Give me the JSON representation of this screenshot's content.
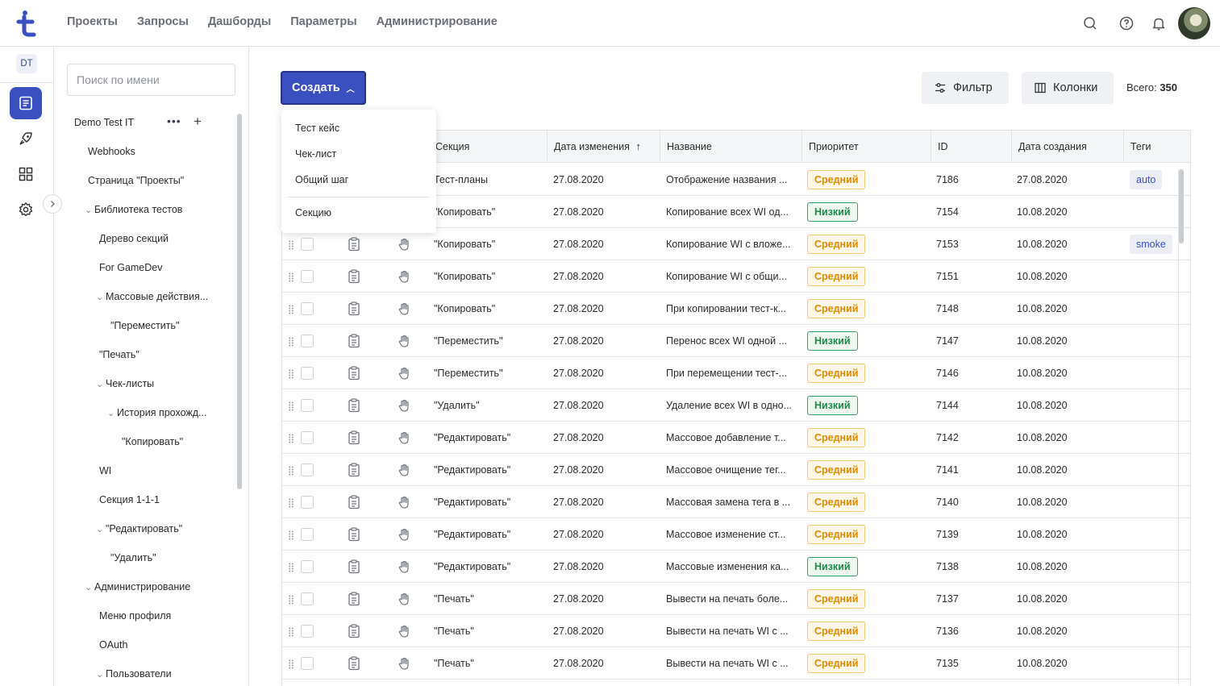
{
  "topnav": [
    "Проекты",
    "Запросы",
    "Дашборды",
    "Параметры",
    "Администрирование"
  ],
  "rail": {
    "project_badge": "DT"
  },
  "tree": {
    "search_placeholder": "Поиск по имени",
    "root": "Demo Test IT",
    "items": [
      {
        "label": "Webhooks",
        "chev": ""
      },
      {
        "label": "Страница \"Проекты\"",
        "chev": ""
      },
      {
        "label": "Библиотека тестов",
        "chev": "⌄"
      },
      {
        "label": "Дерево секций",
        "chev": ""
      },
      {
        "label": "For GameDev",
        "chev": ""
      },
      {
        "label": "Массовые действия...",
        "chev": "⌄"
      },
      {
        "label": "\"Переместить\"",
        "chev": ""
      },
      {
        "label": "\"Печать\"",
        "chev": ""
      },
      {
        "label": "Чек-листы",
        "chev": "⌄"
      },
      {
        "label": "История прохожд...",
        "chev": "⌄"
      },
      {
        "label": "\"Копировать\"",
        "chev": ""
      },
      {
        "label": "WI",
        "chev": ""
      },
      {
        "label": "Секция 1-1-1",
        "chev": ""
      },
      {
        "label": "\"Редактировать\"",
        "chev": "⌄"
      },
      {
        "label": "\"Удалить\"",
        "chev": ""
      },
      {
        "label": "Администрирование",
        "chev": "⌄"
      },
      {
        "label": "Меню профиля",
        "chev": ""
      },
      {
        "label": "OAuth",
        "chev": ""
      },
      {
        "label": "Пользователи",
        "chev": "⌄"
      }
    ]
  },
  "toolbar": {
    "create_label": "Создать",
    "filter_label": "Фильтр",
    "columns_label": "Колонки",
    "total_label": "Всего:",
    "total_value": "350"
  },
  "create_menu": [
    "Тест кейс",
    "Чек-лист",
    "Общий шаг",
    "Секцию"
  ],
  "table": {
    "headers": [
      "Секция",
      "Дата изменения",
      "Название",
      "Приоритет",
      "ID",
      "Дата создания",
      "Теги"
    ],
    "rows": [
      {
        "section": "Тест-планы",
        "modified": "27.08.2020",
        "name": "Отображение названия ...",
        "priority": "Средний",
        "level": "mid",
        "id": "7186",
        "created": "27.08.2020",
        "tag": "auto"
      },
      {
        "section": "\"Копировать\"",
        "modified": "27.08.2020",
        "name": "Копирование всех WI од...",
        "priority": "Низкий",
        "level": "low",
        "id": "7154",
        "created": "10.08.2020",
        "tag": ""
      },
      {
        "section": "\"Копировать\"",
        "modified": "27.08.2020",
        "name": "Копирование WI с вложе...",
        "priority": "Средний",
        "level": "mid",
        "id": "7153",
        "created": "10.08.2020",
        "tag": "smoke"
      },
      {
        "section": "\"Копировать\"",
        "modified": "27.08.2020",
        "name": "Копирование WI с общи...",
        "priority": "Средний",
        "level": "mid",
        "id": "7151",
        "created": "10.08.2020",
        "tag": ""
      },
      {
        "section": "\"Копировать\"",
        "modified": "27.08.2020",
        "name": "При копировании тест-к...",
        "priority": "Средний",
        "level": "mid",
        "id": "7148",
        "created": "10.08.2020",
        "tag": ""
      },
      {
        "section": "\"Переместить\"",
        "modified": "27.08.2020",
        "name": "Перенос всех WI одной ...",
        "priority": "Низкий",
        "level": "low",
        "id": "7147",
        "created": "10.08.2020",
        "tag": ""
      },
      {
        "section": "\"Переместить\"",
        "modified": "27.08.2020",
        "name": "При перемещении тест-...",
        "priority": "Средний",
        "level": "mid",
        "id": "7146",
        "created": "10.08.2020",
        "tag": ""
      },
      {
        "section": "\"Удалить\"",
        "modified": "27.08.2020",
        "name": "Удаление всех WI в одно...",
        "priority": "Низкий",
        "level": "low",
        "id": "7144",
        "created": "10.08.2020",
        "tag": ""
      },
      {
        "section": "\"Редактировать\"",
        "modified": "27.08.2020",
        "name": "Массовое добавление т...",
        "priority": "Средний",
        "level": "mid",
        "id": "7142",
        "created": "10.08.2020",
        "tag": ""
      },
      {
        "section": "\"Редактировать\"",
        "modified": "27.08.2020",
        "name": "Массовое очищение тег...",
        "priority": "Средний",
        "level": "mid",
        "id": "7141",
        "created": "10.08.2020",
        "tag": ""
      },
      {
        "section": "\"Редактировать\"",
        "modified": "27.08.2020",
        "name": "Массовая замена тега в ...",
        "priority": "Средний",
        "level": "mid",
        "id": "7140",
        "created": "10.08.2020",
        "tag": ""
      },
      {
        "section": "\"Редактировать\"",
        "modified": "27.08.2020",
        "name": "Массовое изменение ст...",
        "priority": "Средний",
        "level": "mid",
        "id": "7139",
        "created": "10.08.2020",
        "tag": ""
      },
      {
        "section": "\"Редактировать\"",
        "modified": "27.08.2020",
        "name": "Массовые изменения ка...",
        "priority": "Низкий",
        "level": "low",
        "id": "7138",
        "created": "10.08.2020",
        "tag": ""
      },
      {
        "section": "\"Печать\"",
        "modified": "27.08.2020",
        "name": "Вывести на печать боле...",
        "priority": "Средний",
        "level": "mid",
        "id": "7137",
        "created": "10.08.2020",
        "tag": ""
      },
      {
        "section": "\"Печать\"",
        "modified": "27.08.2020",
        "name": "Вывести на печать WI с ...",
        "priority": "Средний",
        "level": "mid",
        "id": "7136",
        "created": "10.08.2020",
        "tag": ""
      },
      {
        "section": "\"Печать\"",
        "modified": "27.08.2020",
        "name": "Вывести на печать WI с ...",
        "priority": "Средний",
        "level": "mid",
        "id": "7135",
        "created": "10.08.2020",
        "tag": ""
      }
    ]
  },
  "colors": {
    "accent": "#3a4fc0",
    "priority_mid": "#e08a00",
    "priority_low": "#1d8a4a"
  }
}
